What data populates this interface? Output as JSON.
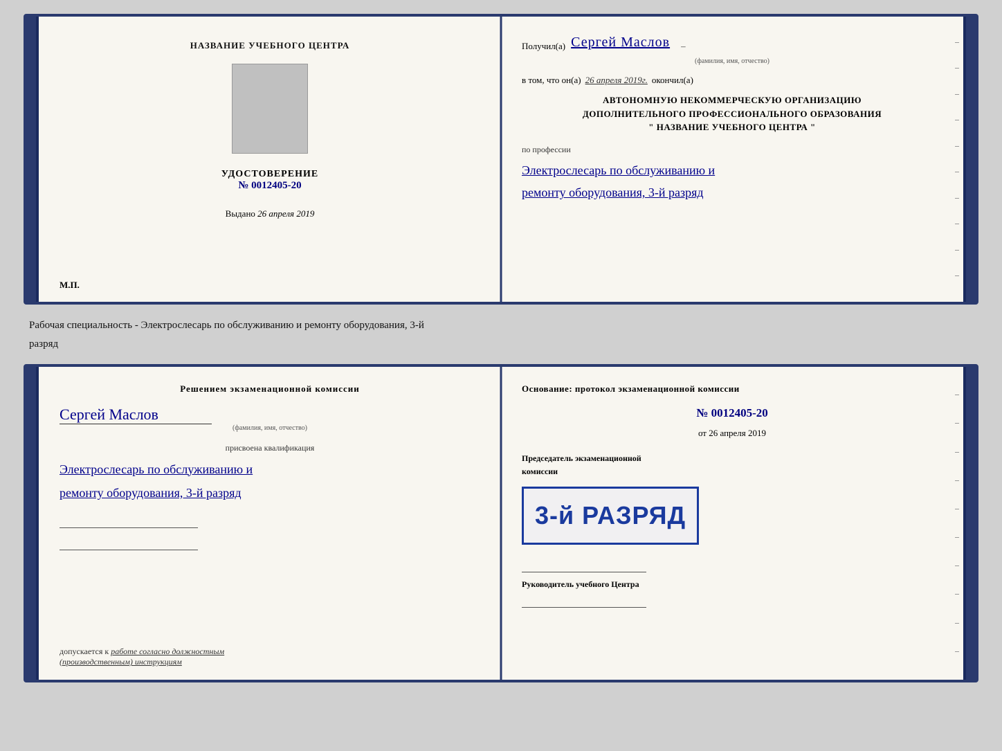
{
  "doc1": {
    "left": {
      "center_title": "НАЗВАНИЕ УЧЕБНОГО ЦЕНТРА",
      "udostoverenie_label": "УДОСТОВЕРЕНИЕ",
      "number_prefix": "№",
      "number": "0012405-20",
      "vydano_prefix": "Выдано",
      "vydano_date": "26 апреля 2019",
      "mp_label": "М.П."
    },
    "right": {
      "poluchil_label": "Получил(а)",
      "recipient_name": "Сергей Маслов",
      "fio_subtitle": "(фамилия, имя, отчество)",
      "vtom_prefix": "в том, что он(а)",
      "vtom_date": "26 апреля 2019г.",
      "okончил_label": "окончил(а)",
      "org_line1": "АВТОНОМНУЮ НЕКОММЕРЧЕСКУЮ ОРГАНИЗАЦИЮ",
      "org_line2": "ДОПОЛНИТЕЛЬНОГО ПРОФЕССИОНАЛЬНОГО ОБРАЗОВАНИЯ",
      "org_line3": "\" НАЗВАНИЕ УЧЕБНОГО ЦЕНТРА \"",
      "po_professii_label": "по профессии",
      "profession_line1": "Электрослесарь по обслуживанию и",
      "profession_line2": "ремонту оборудования, 3-й разряд"
    }
  },
  "between_text_line1": "Рабочая специальность - Электрослесарь по обслуживанию и ремонту оборудования, 3-й",
  "between_text_line2": "разряд",
  "doc2": {
    "left": {
      "resheniyem_title": "Решением экзаменационной комиссии",
      "name": "Сергей Маслов",
      "fio_subtitle": "(фамилия, имя, отчество)",
      "prisvoena_label": "присвоена квалификация",
      "qualification_line1": "Электрослесарь по обслуживанию и",
      "qualification_line2": "ремонту оборудования, 3-й разряд",
      "dopusk_prefix": "допускается к",
      "dopusk_text": "работе согласно должностным (производственным) инструкциям"
    },
    "right": {
      "osnovanie_label": "Основание: протокол экзаменационной комиссии",
      "number_prefix": "№",
      "number": "0012405-20",
      "ot_prefix": "от",
      "ot_date": "26 апреля 2019",
      "predsedatel_label": "Председатель экзаменационной комиссии",
      "stamp_text": "3-й РАЗРЯД",
      "rukovoditel_label": "Руководитель учебного Центра"
    }
  }
}
